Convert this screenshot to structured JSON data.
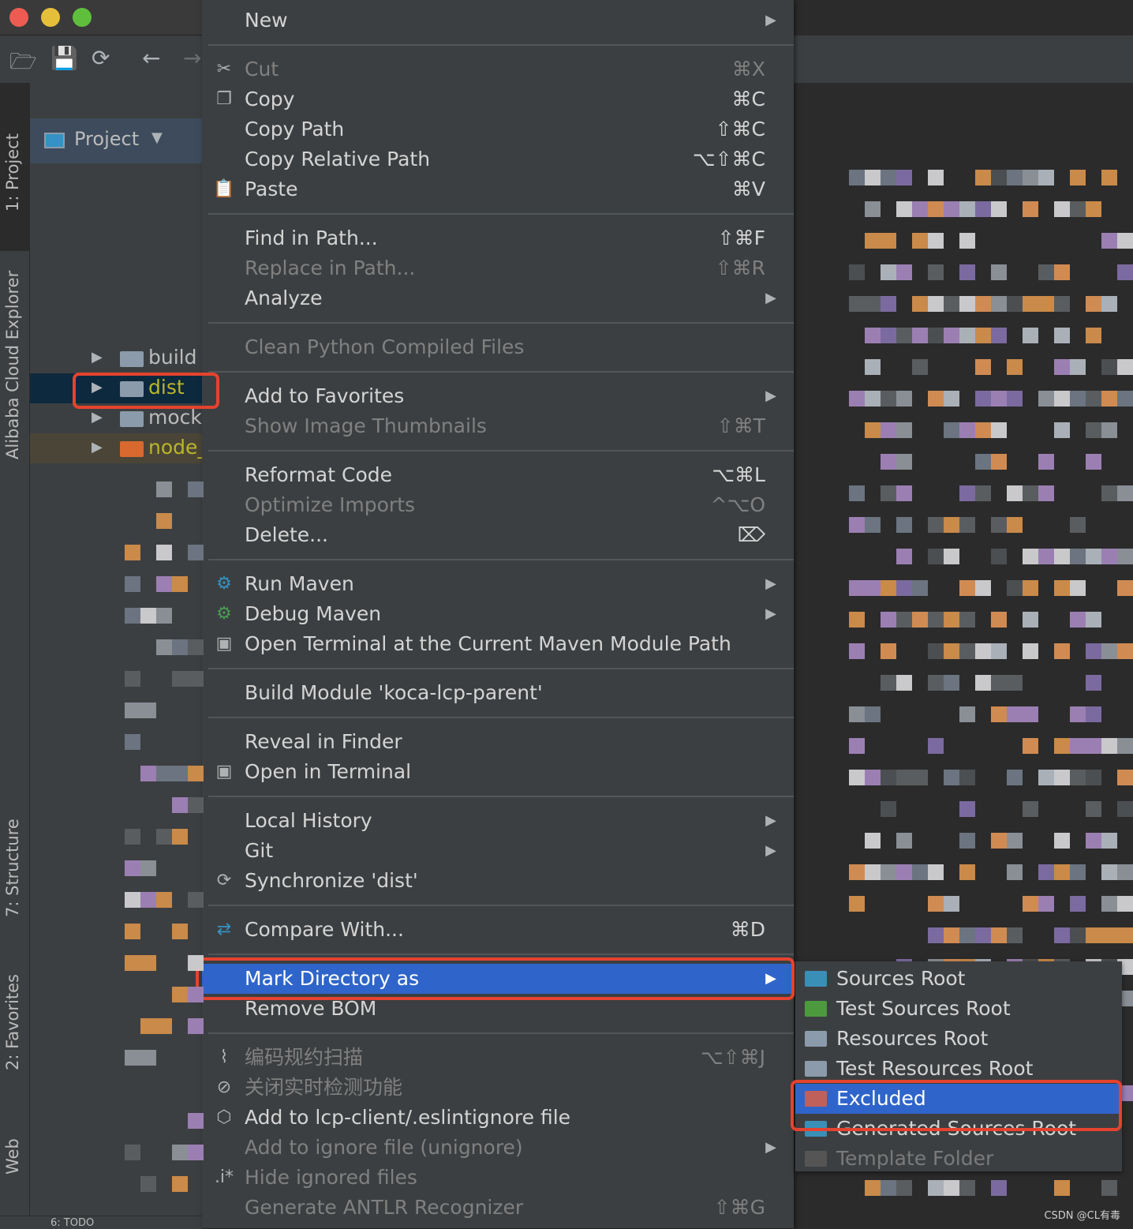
{
  "window": {
    "traffic_lights": [
      "#ee5b52",
      "#e6bf3a",
      "#5fbf3d"
    ]
  },
  "toolbar": {
    "icons": [
      "open-folder-icon",
      "save-icon",
      "sync-icon",
      "back-icon",
      "forward-icon"
    ]
  },
  "tool_stripe": {
    "project": "1: Project",
    "alibaba": "Alibaba Cloud Explorer",
    "structure": "7: Structure",
    "favorites": "2: Favorites",
    "web": "Web",
    "todo": "6: TODO"
  },
  "project_panel": {
    "title": "Project",
    "tree": [
      {
        "name": "build",
        "color": "#bbbbbb",
        "folder": "#8b9bab"
      },
      {
        "name": "dist",
        "color": "#bbb529",
        "folder": "#8b9bab",
        "selected": true
      },
      {
        "name": "mock",
        "color": "#bbbbbb",
        "folder": "#8b9bab"
      },
      {
        "name": "node_",
        "color": "#bbb529",
        "folder": "#d9692f"
      }
    ]
  },
  "context_menu": {
    "groups": [
      [
        {
          "label": "New",
          "submenu": true
        }
      ],
      [
        {
          "label": "Cut",
          "shortcut": "⌘X",
          "icon": "scissors-icon",
          "glyph": "✂",
          "disabled": true
        },
        {
          "label": "Copy",
          "shortcut": "⌘C",
          "icon": "copy-icon",
          "glyph": "❐"
        },
        {
          "label": "Copy Path",
          "shortcut": "⇧⌘C"
        },
        {
          "label": "Copy Relative Path",
          "shortcut": "⌥⇧⌘C"
        },
        {
          "label": "Paste",
          "shortcut": "⌘V",
          "icon": "clipboard-icon",
          "glyph": "📋"
        }
      ],
      [
        {
          "label": "Find in Path...",
          "shortcut": "⇧⌘F"
        },
        {
          "label": "Replace in Path...",
          "shortcut": "⇧⌘R",
          "disabled": true
        },
        {
          "label": "Analyze",
          "submenu": true
        }
      ],
      [
        {
          "label": "Clean Python Compiled Files",
          "disabled": true
        }
      ],
      [
        {
          "label": "Add to Favorites",
          "submenu": true
        },
        {
          "label": "Show Image Thumbnails",
          "shortcut": "⇧⌘T",
          "disabled": true
        }
      ],
      [
        {
          "label": "Reformat Code",
          "shortcut": "⌥⌘L"
        },
        {
          "label": "Optimize Imports",
          "shortcut": "^⌥O",
          "disabled": true
        },
        {
          "label": "Delete...",
          "shortcut": "⌦"
        }
      ],
      [
        {
          "label": "Run Maven",
          "submenu": true,
          "icon": "maven-run-gear-icon",
          "glyph": "⚙",
          "glyph_color": "#3592c4"
        },
        {
          "label": "Debug Maven",
          "submenu": true,
          "icon": "maven-debug-gear-icon",
          "glyph": "⚙",
          "glyph_color": "#499c54"
        },
        {
          "label": "Open Terminal at the Current Maven Module Path",
          "icon": "terminal-icon",
          "glyph": "▣"
        }
      ],
      [
        {
          "label": "Build Module 'koca-lcp-parent'"
        }
      ],
      [
        {
          "label": "Reveal in Finder"
        },
        {
          "label": "Open in Terminal",
          "icon": "terminal-icon",
          "glyph": "▣"
        }
      ],
      [
        {
          "label": "Local History",
          "submenu": true
        },
        {
          "label": "Git",
          "submenu": true
        },
        {
          "label": "Synchronize 'dist'",
          "icon": "sync-icon",
          "glyph": "⟳"
        }
      ],
      [
        {
          "label": "Compare With...",
          "shortcut": "⌘D",
          "icon": "compare-arrows-icon",
          "glyph": "⇄",
          "glyph_color": "#3592c4"
        }
      ],
      [
        {
          "label": "Mark Directory as",
          "submenu": true,
          "selected": true
        },
        {
          "label": "Remove BOM"
        }
      ],
      [
        {
          "label": "编码规约扫描",
          "shortcut": "⌥⇧⌘J",
          "icon": "scan-chart-icon",
          "glyph": "⌇",
          "disabled": true
        },
        {
          "label": "关闭实时检测功能",
          "icon": "forbidden-icon",
          "glyph": "⊘",
          "disabled": true
        },
        {
          "label": "Add to lcp-client/.eslintignore file",
          "icon": "eslint-hexagon-icon",
          "glyph": "⬡"
        },
        {
          "label": "Add to ignore file (unignore)",
          "submenu": true,
          "disabled": true
        },
        {
          "label": "Hide ignored files",
          "icon": "ignore-file-icon",
          "glyph": ".i*",
          "disabled": true
        },
        {
          "label": "Generate ANTLR Recognizer",
          "shortcut": "⇧⌘G",
          "disabled": true
        }
      ]
    ]
  },
  "mark_directory_submenu": [
    {
      "label": "Sources Root",
      "color": "#3a8fb7"
    },
    {
      "label": "Test Sources Root",
      "color": "#4d9a3e"
    },
    {
      "label": "Resources Root",
      "color": "#8b9bab"
    },
    {
      "label": "Test Resources Root",
      "color": "#8b9bab"
    },
    {
      "label": "Excluded",
      "color": "#c0605a",
      "selected": true
    },
    {
      "label": "Generated Sources Root",
      "color": "#3a8fb7"
    },
    {
      "label": "Template Folder",
      "color": "#555555",
      "disabled": true
    }
  ],
  "colors": {
    "selection": "#2f65ca",
    "highlight_box": "#e5432f",
    "menu_bg": "#3c3f41"
  },
  "watermark": "CSDN @CL有毒"
}
